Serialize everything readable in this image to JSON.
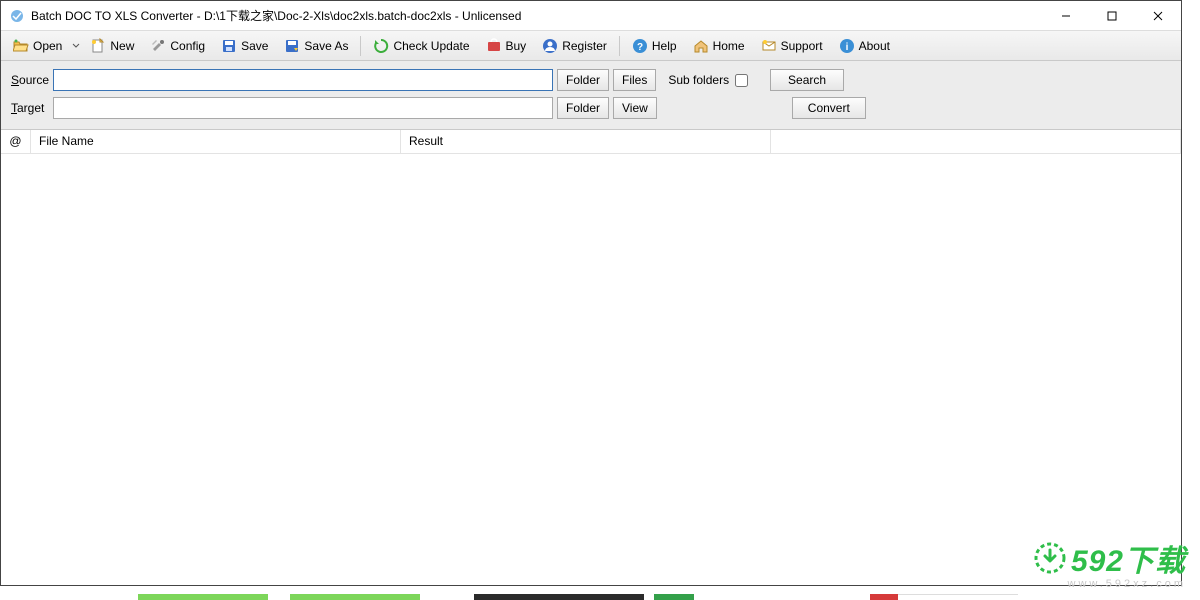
{
  "titlebar": {
    "text": "Batch DOC TO XLS Converter - D:\\1下载之家\\Doc-2-Xls\\doc2xls.batch-doc2xls - Unlicensed"
  },
  "toolbar": {
    "open": "Open",
    "new": "New",
    "config": "Config",
    "save": "Save",
    "saveas": "Save As",
    "check": "Check Update",
    "buy": "Buy",
    "register": "Register",
    "help": "Help",
    "home": "Home",
    "support": "Support",
    "about": "About"
  },
  "form": {
    "source_label_pre": "S",
    "source_label_rest": "ource",
    "source_value": "",
    "target_label_pre": "T",
    "target_label_rest": "arget",
    "target_value": "",
    "folder_btn": "Folder",
    "files_btn": "Files",
    "view_btn": "View",
    "subfolders_label": "Sub folders",
    "search_btn": "Search",
    "convert_btn": "Convert"
  },
  "table": {
    "col_at": "@",
    "col_filename": "File Name",
    "col_result": "Result"
  },
  "watermark": {
    "text": "592下载",
    "url": "www.592xz.com"
  }
}
